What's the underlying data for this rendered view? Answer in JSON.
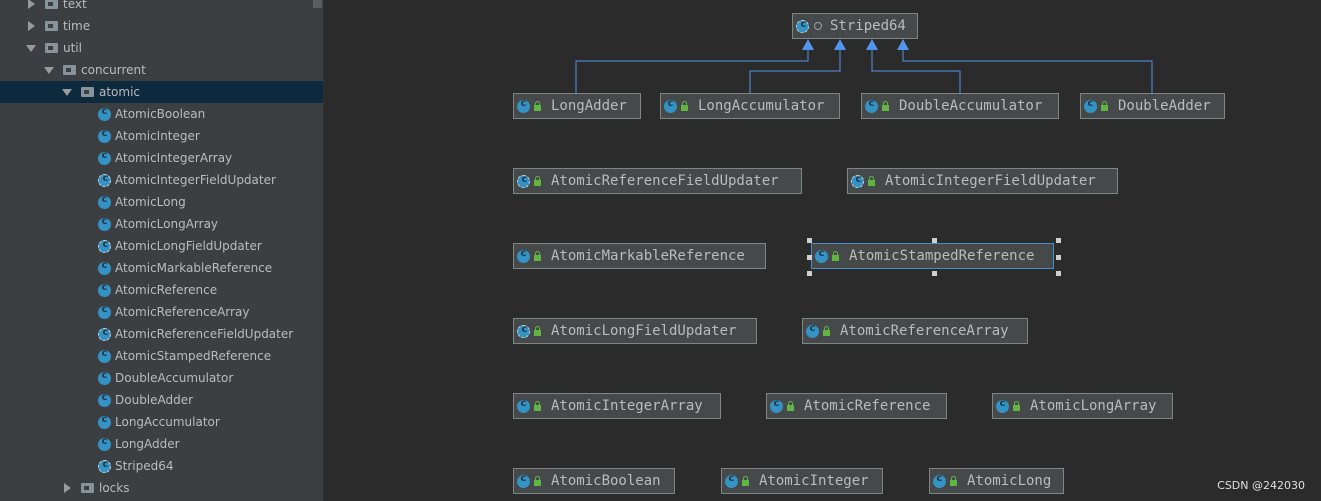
{
  "sidebar": {
    "items": [
      {
        "label": "text",
        "kind": "package",
        "state": "collapsed"
      },
      {
        "label": "time",
        "kind": "package",
        "state": "collapsed"
      },
      {
        "label": "util",
        "kind": "package",
        "state": "expanded"
      },
      {
        "label": "concurrent",
        "kind": "package",
        "state": "expanded"
      },
      {
        "label": "atomic",
        "kind": "package",
        "state": "expanded",
        "selected": true
      },
      {
        "label": "AtomicBoolean",
        "kind": "class"
      },
      {
        "label": "AtomicInteger",
        "kind": "class"
      },
      {
        "label": "AtomicIntegerArray",
        "kind": "class"
      },
      {
        "label": "AtomicIntegerFieldUpdater",
        "kind": "abstract-class"
      },
      {
        "label": "AtomicLong",
        "kind": "class"
      },
      {
        "label": "AtomicLongArray",
        "kind": "class"
      },
      {
        "label": "AtomicLongFieldUpdater",
        "kind": "abstract-class"
      },
      {
        "label": "AtomicMarkableReference",
        "kind": "class"
      },
      {
        "label": "AtomicReference",
        "kind": "class"
      },
      {
        "label": "AtomicReferenceArray",
        "kind": "class"
      },
      {
        "label": "AtomicReferenceFieldUpdater",
        "kind": "abstract-class"
      },
      {
        "label": "AtomicStampedReference",
        "kind": "class"
      },
      {
        "label": "DoubleAccumulator",
        "kind": "class"
      },
      {
        "label": "DoubleAdder",
        "kind": "class"
      },
      {
        "label": "LongAccumulator",
        "kind": "class"
      },
      {
        "label": "LongAdder",
        "kind": "class"
      },
      {
        "label": "Striped64",
        "kind": "abstract-class"
      },
      {
        "label": "locks",
        "kind": "package",
        "state": "collapsed"
      }
    ]
  },
  "diagram": {
    "nodes": [
      {
        "id": "striped64",
        "label": "Striped64",
        "kind": "abstract-class"
      },
      {
        "id": "longadder",
        "label": "LongAdder",
        "kind": "class"
      },
      {
        "id": "longaccumulator",
        "label": "LongAccumulator",
        "kind": "class"
      },
      {
        "id": "doubleaccumulator",
        "label": "DoubleAccumulator",
        "kind": "class"
      },
      {
        "id": "doubleadder",
        "label": "DoubleAdder",
        "kind": "class"
      },
      {
        "id": "atomicreferencefieldupdater",
        "label": "AtomicReferenceFieldUpdater",
        "kind": "abstract-class"
      },
      {
        "id": "atomicintegerfieldupdater",
        "label": "AtomicIntegerFieldUpdater",
        "kind": "abstract-class"
      },
      {
        "id": "atomicmarkablereference",
        "label": "AtomicMarkableReference",
        "kind": "class"
      },
      {
        "id": "atomicstampedreference",
        "label": "AtomicStampedReference",
        "kind": "class",
        "selected": true
      },
      {
        "id": "atomiclongfieldupdater",
        "label": "AtomicLongFieldUpdater",
        "kind": "abstract-class"
      },
      {
        "id": "atomicreferencearray",
        "label": "AtomicReferenceArray",
        "kind": "class"
      },
      {
        "id": "atomicintegerarray",
        "label": "AtomicIntegerArray",
        "kind": "class"
      },
      {
        "id": "atomicreference",
        "label": "AtomicReference",
        "kind": "class"
      },
      {
        "id": "atomiclongarray",
        "label": "AtomicLongArray",
        "kind": "class"
      },
      {
        "id": "atomicboolean",
        "label": "AtomicBoolean",
        "kind": "class"
      },
      {
        "id": "atomicinteger",
        "label": "AtomicInteger",
        "kind": "class"
      },
      {
        "id": "atomiclong",
        "label": "AtomicLong",
        "kind": "class"
      }
    ],
    "edges": [
      {
        "from": "longadder",
        "to": "striped64",
        "relation": "extends"
      },
      {
        "from": "longaccumulator",
        "to": "striped64",
        "relation": "extends"
      },
      {
        "from": "doubleaccumulator",
        "to": "striped64",
        "relation": "extends"
      },
      {
        "from": "doubleadder",
        "to": "striped64",
        "relation": "extends"
      }
    ],
    "edge_color": "#5394ec"
  },
  "watermark": "CSDN @242030",
  "colors": {
    "sidebar_bg": "#3c3f41",
    "selection_bg": "#0d293e",
    "canvas_bg": "#2b2b2b",
    "node_bg": "#45494a",
    "class_icon": "#3592c4",
    "access_icon": "#62b543"
  }
}
